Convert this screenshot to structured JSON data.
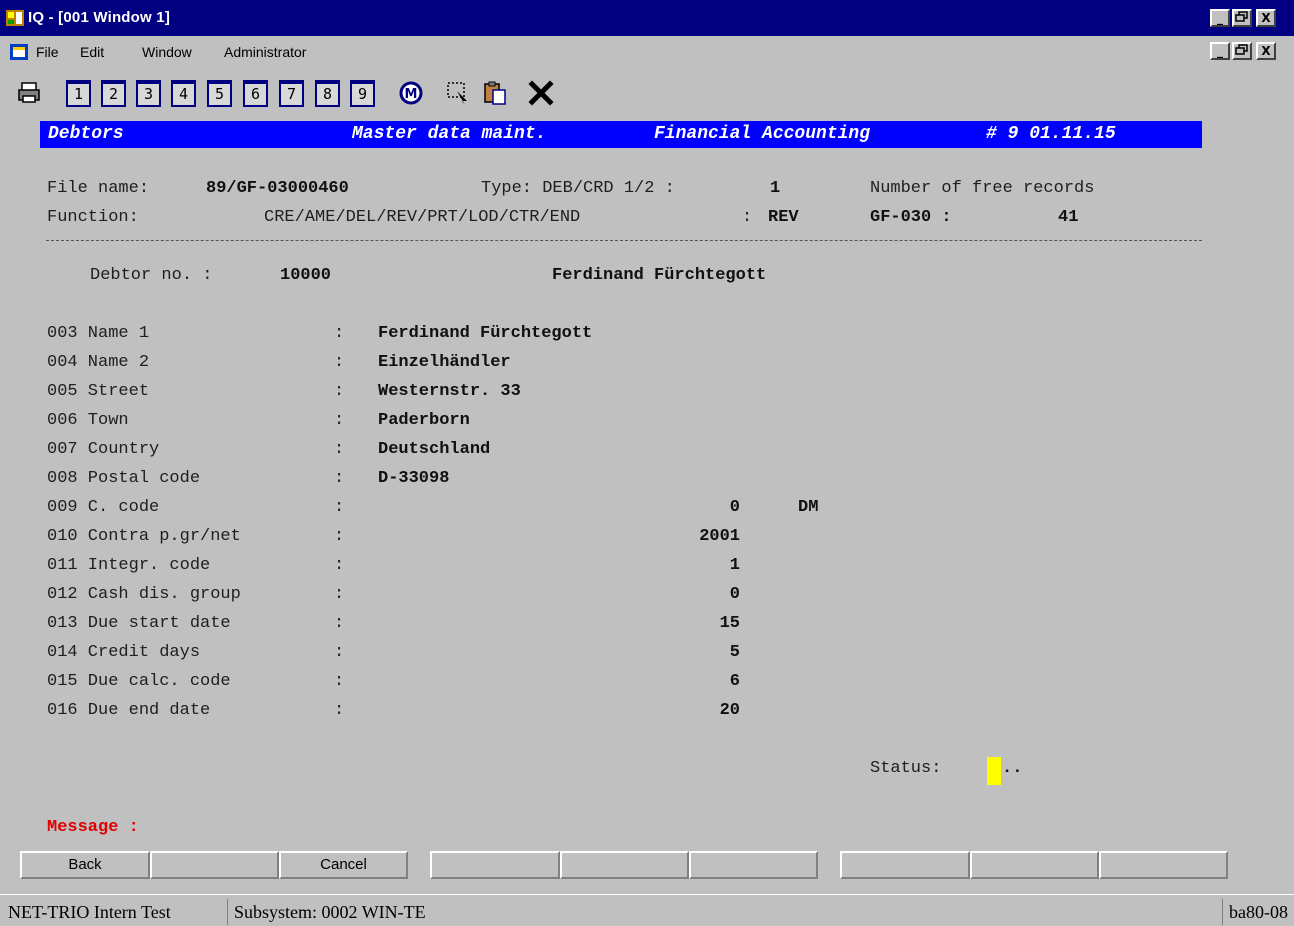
{
  "window": {
    "title": "IQ - [001  Window 1]",
    "controls": [
      "_",
      "▫",
      "X"
    ]
  },
  "menu": {
    "items": [
      "File",
      "Edit",
      "Window",
      "Administrator"
    ]
  },
  "toolbar": {
    "numbers": [
      "1",
      "2",
      "3",
      "4",
      "5",
      "6",
      "7",
      "8",
      "9"
    ],
    "icons": [
      "printer-icon",
      "m-icon",
      "select-icon",
      "clipboard-icon",
      "close-icon"
    ]
  },
  "header": {
    "module": "Debtors",
    "subtitle": "Master data maint.",
    "area": "Financial Accounting",
    "version": "# 9 01.11.15"
  },
  "info": {
    "file_label": "File name:",
    "file_value": "89/GF-03000460",
    "type_label": "Type: DEB/CRD 1/2 :",
    "type_value": "1",
    "free_label": "Number of free records",
    "function_label": "Function:",
    "function_options": "CRE/AME/DEL/REV/PRT/LOD/CTR/END",
    "function_sep": ":",
    "function_value": "REV",
    "gf_label": "GF-030 :",
    "free_value": "41"
  },
  "debtor": {
    "label": "Debtor no. :",
    "number": "10000",
    "name": "Ferdinand Fürchtegott"
  },
  "fields": [
    {
      "label": "003 Name 1",
      "sep": ":",
      "value": "Ferdinand Fürchtegott"
    },
    {
      "label": "004 Name 2",
      "sep": ":",
      "value": "Einzelhändler"
    },
    {
      "label": "005 Street",
      "sep": ":",
      "value": "Westernstr. 33"
    },
    {
      "label": "006 Town",
      "sep": ":",
      "value": "Paderborn"
    },
    {
      "label": "007 Country",
      "sep": ":",
      "value": "Deutschland"
    },
    {
      "label": "008 Postal code",
      "sep": ":",
      "value": "D-33098"
    }
  ],
  "numfields": [
    {
      "label": "009 C. code",
      "sep": ":",
      "value": "0",
      "extra": "DM"
    },
    {
      "label": "010 Contra p.gr/net",
      "sep": ":",
      "value": "2001"
    },
    {
      "label": "011 Integr. code",
      "sep": ":",
      "value": "1"
    },
    {
      "label": "012 Cash dis. group",
      "sep": ":",
      "value": "0"
    },
    {
      "label": "013 Due start date",
      "sep": ":",
      "value": "15"
    },
    {
      "label": "014 Credit days",
      "sep": ":",
      "value": "5"
    },
    {
      "label": "015 Due calc. code",
      "sep": ":",
      "value": "6"
    },
    {
      "label": "016 Due end date",
      "sep": ":",
      "value": "20"
    }
  ],
  "status": {
    "label": "Status:",
    "value": ".."
  },
  "message": {
    "label": "Message :"
  },
  "buttons": [
    "Back",
    "",
    "Cancel",
    "",
    "",
    "",
    "",
    "",
    "",
    "",
    ""
  ],
  "statusbar": {
    "left": "NET-TRIO Intern Test",
    "middle": "Subsystem: 0002 WIN-TE",
    "right": "ba80-08"
  },
  "colors": {
    "titlebar": "#000080",
    "header": "#0000ff",
    "message": "#e00000",
    "cursor": "#ffff00"
  }
}
